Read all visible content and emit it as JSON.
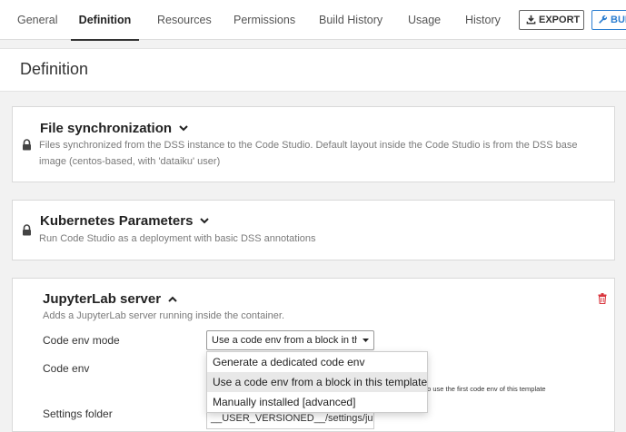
{
  "tabs": [
    {
      "label": "General",
      "active": false
    },
    {
      "label": "Definition",
      "active": true
    },
    {
      "label": "Resources",
      "active": false
    },
    {
      "label": "Permissions",
      "active": false
    },
    {
      "label": "Build History",
      "active": false
    },
    {
      "label": "Usage",
      "active": false
    },
    {
      "label": "History",
      "active": false
    }
  ],
  "buttons": {
    "export": "EXPORT",
    "build": "BUILD"
  },
  "page_title": "Definition",
  "blocks": {
    "file_sync": {
      "title": "File synchronization",
      "description": "Files synchronized from the DSS instance to the Code Studio. Default layout inside the Code Studio is from the DSS base image (centos-based, with 'dataiku' user)"
    },
    "kubernetes": {
      "title": "Kubernetes Parameters",
      "description": "Run Code Studio as a deployment with basic DSS annotations"
    },
    "jupyter": {
      "title": "JupyterLab server",
      "description": "Adds a JupyterLab server running inside the container.",
      "code_env_mode_label": "Code env mode",
      "code_env_mode_value": "Use a code env from a block in this template",
      "code_env_label": "Code env",
      "code_env_help": "to use the first code env of this template",
      "settings_folder_label": "Settings folder",
      "settings_folder_value": "__USER_VERSIONED__/settings/jupyter",
      "dropdown_options": [
        "Generate a dedicated code env",
        "Use a code env from a block in this template",
        "Manually installed [advanced]"
      ]
    }
  },
  "colors": {
    "accent": "#2d7fd1",
    "danger": "#d9363e"
  }
}
